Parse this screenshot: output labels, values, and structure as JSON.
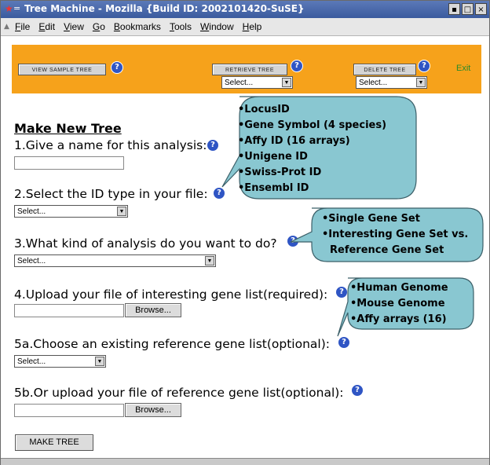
{
  "window": {
    "title": "Tree Machine - Mozilla {Build ID: 2002101420-SuSE}",
    "controls": [
      "▪",
      "□",
      "×"
    ]
  },
  "menu": [
    "File",
    "Edit",
    "View",
    "Go",
    "Bookmarks",
    "Tools",
    "Window",
    "Help"
  ],
  "toolbar": {
    "view_sample": "VIEW SAMPLE TREE",
    "retrieve": "RETRIEVE TREE",
    "delete": "DELETE TREE",
    "retrieve_select": "Select...",
    "delete_select": "Select...",
    "exit": "Exit",
    "help": "?"
  },
  "form": {
    "heading": "Make New Tree",
    "q1": "1.Give a name for this analysis:",
    "q2": "2.Select the ID type in your file:",
    "q2_select": "Select...",
    "q3": "3.What kind of analysis do you want to do?",
    "q3_select": "Select...",
    "q4": "4.Upload your file of interesting gene list(required):",
    "q4_browse": "Browse...",
    "q5a": "5a.Choose an existing reference gene list(optional):",
    "q5a_select": "Select...",
    "q5b": "5b.Or upload your file of reference gene list(optional):",
    "q5b_browse": "Browse...",
    "make_tree": "MAKE TREE"
  },
  "callouts": {
    "id_types": [
      "•LocusID",
      "•Gene Symbol (4 species)",
      "•Affy ID (16 arrays)",
      "•Unigene ID",
      "•Swiss-Prot ID",
      "•Ensembl ID"
    ],
    "analysis": [
      "•Single Gene Set",
      "•Interesting Gene Set vs.",
      "Reference Gene Set"
    ],
    "reference": [
      "•Human Genome",
      "•Mouse Genome",
      "•Affy arrays (16)"
    ]
  },
  "colors": {
    "toolbar": "#f6a21b",
    "callout_fill": "#89c7d1",
    "help_icon": "#2f55c4",
    "titlebar": "#3b5b9e",
    "exit_link": "#2a8a2a"
  }
}
